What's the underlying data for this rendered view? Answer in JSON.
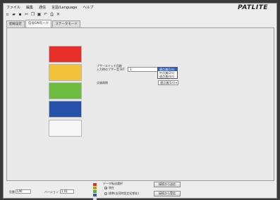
{
  "menu": [
    "ファイル",
    "編集",
    "通信",
    "言語/Language",
    "ヘルプ"
  ],
  "brand": "PATLITE",
  "toolbar_icons": [
    "new-icon",
    "open-icon",
    "save-icon",
    "cut-icon",
    "copy-icon",
    "paste-icon",
    "undo-icon",
    "print-icon",
    "delete-icon"
  ],
  "tabs": [
    "配線設定",
    "信号ONモード",
    "ステータモード"
  ],
  "swatches": [
    {
      "name": "red",
      "color": "#e8302a"
    },
    {
      "name": "yellow",
      "color": "#f3c13a"
    },
    {
      "name": "green",
      "color": "#6dbb3f"
    },
    {
      "name": "blue",
      "color": "#2651a9"
    },
    {
      "name": "white",
      "color": "#f7f7f7"
    }
  ],
  "settings": {
    "buzzer_label_1": "ブザースイッチ回路",
    "buzzer_label_2": "入力時のブザー音 B/T",
    "buzzer_value": "1",
    "mode_label": "点滅周期",
    "mode_value": "遅点滅(1/s)",
    "mode_options": [
      "遅点滅(1/s)",
      "中点滅(2/s)",
      "速点滅(4/s)"
    ]
  },
  "bottom": {
    "label_a": "型番",
    "value_a": "LA6",
    "label_b": "バージョン",
    "value_b": "1.01",
    "section_label": "データ転送選択",
    "radio_1": "現在",
    "radio_2": "標準(出荷時設定初期化)",
    "button_1": "接続から送信",
    "button_2": "接続から受信"
  }
}
